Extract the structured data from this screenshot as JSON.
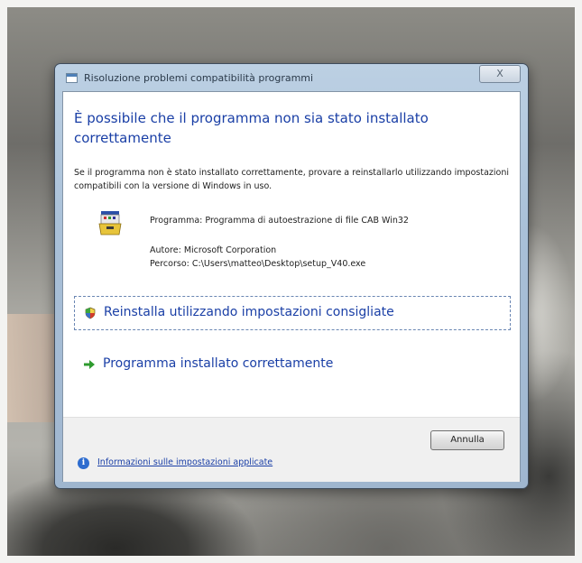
{
  "window": {
    "title": "Risoluzione problemi compatibilità programmi",
    "close_symbol": "X"
  },
  "main": {
    "heading": "È possibile che il programma non sia stato installato correttamente",
    "description": "Se il programma non è stato installato correttamente, provare a reinstallarlo utilizzando impostazioni compatibili con la versione di Windows in uso.",
    "program_line": "Programma: Programma di autoestrazione di file CAB Win32",
    "author_line": "Autore: Microsoft Corporation",
    "path_line": "Percorso: C:\\Users\\matteo\\Desktop\\setup_V40.exe",
    "program_icon": "installer-program-icon"
  },
  "options": [
    {
      "label": "Reinstalla utilizzando impostazioni consigliate",
      "icon": "shield-icon"
    },
    {
      "label": "Programma installato correttamente",
      "icon": "green-arrow-icon"
    }
  ],
  "footer": {
    "cancel_label": "Annulla",
    "info_link": "Informazioni sulle impostazioni applicate",
    "info_icon": "info-icon"
  },
  "colors": {
    "heading_blue": "#1a3fa6",
    "window_frame": "#a9c0d8",
    "arrow_green": "#2f9b2f"
  }
}
